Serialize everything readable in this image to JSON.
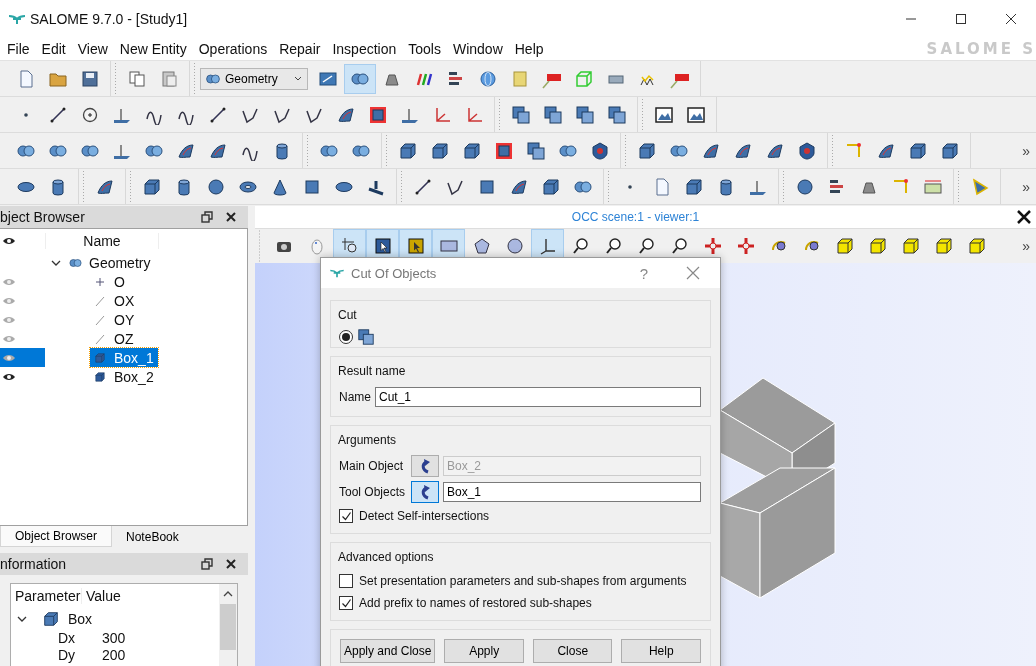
{
  "window": {
    "title": "SALOME  9.7.0 - [Study1]"
  },
  "menu": [
    "File",
    "Edit",
    "View",
    "New Entity",
    "Operations",
    "Repair",
    "Inspection",
    "Tools",
    "Window",
    "Help"
  ],
  "brand": "SALOME S",
  "toolbars": [
    {
      "groups": [
        {
          "buttons": [
            {
              "pressed": false
            },
            {
              "pressed": false
            },
            {
              "pressed": false
            }
          ]
        },
        {
          "buttons": [
            {
              "pressed": false
            },
            {
              "pressed": false
            }
          ]
        },
        {
          "combo": "Geometry",
          "buttons": [
            {
              "pressed": false
            },
            {
              "pressed": true
            },
            {
              "pressed": false
            },
            {
              "pressed": false
            },
            {
              "pressed": false
            },
            {
              "pressed": false
            },
            {
              "pressed": false
            },
            {
              "pressed": false
            },
            {
              "pressed": false
            },
            {
              "pressed": false
            },
            {
              "pressed": false
            },
            {
              "pressed": false
            }
          ]
        }
      ]
    },
    {
      "groups": [
        {
          "buttons": [
            {
              "pressed": false
            },
            {
              "pressed": false
            },
            {
              "pressed": false
            },
            {
              "pressed": false
            },
            {
              "pressed": false
            },
            {
              "pressed": false
            },
            {
              "pressed": false
            },
            {
              "pressed": false
            },
            {
              "pressed": false
            },
            {
              "pressed": false
            },
            {
              "pressed": false
            },
            {
              "pressed": false
            },
            {
              "pressed": false
            },
            {
              "pressed": false
            },
            {
              "pressed": false
            }
          ]
        },
        {
          "buttons": [
            {
              "pressed": false
            },
            {
              "pressed": false
            },
            {
              "pressed": false
            },
            {
              "pressed": false
            }
          ]
        },
        {
          "buttons": [
            {
              "pressed": false
            },
            {
              "pressed": false
            }
          ]
        }
      ]
    },
    {
      "overflow": "»",
      "groups": [
        {
          "buttons": [
            {
              "pressed": false
            },
            {
              "pressed": false
            },
            {
              "pressed": false
            },
            {
              "pressed": false
            },
            {
              "pressed": false
            },
            {
              "pressed": false
            },
            {
              "pressed": false
            },
            {
              "pressed": false
            },
            {
              "pressed": false
            }
          ]
        },
        {
          "buttons": [
            {
              "pressed": false
            },
            {
              "pressed": false
            }
          ]
        },
        {
          "buttons": [
            {
              "pressed": false
            },
            {
              "pressed": false
            },
            {
              "pressed": false
            },
            {
              "pressed": false
            },
            {
              "pressed": false
            },
            {
              "pressed": false
            },
            {
              "pressed": false
            }
          ]
        },
        {
          "buttons": [
            {
              "pressed": false
            },
            {
              "pressed": false
            },
            {
              "pressed": false
            },
            {
              "pressed": false
            },
            {
              "pressed": false
            },
            {
              "pressed": false
            }
          ]
        },
        {
          "buttons": [
            {
              "pressed": false
            },
            {
              "pressed": false
            },
            {
              "pressed": false
            },
            {
              "pressed": false
            }
          ]
        }
      ]
    },
    {
      "overflow": "»",
      "groups": [
        {
          "buttons": [
            {
              "pressed": false
            },
            {
              "pressed": false
            }
          ]
        },
        {
          "buttons": [
            {
              "pressed": false
            }
          ]
        },
        {
          "buttons": [
            {
              "pressed": false
            },
            {
              "pressed": false
            },
            {
              "pressed": false
            },
            {
              "pressed": false
            },
            {
              "pressed": false
            },
            {
              "pressed": false
            },
            {
              "pressed": false
            },
            {
              "pressed": false
            }
          ]
        },
        {
          "buttons": [
            {
              "pressed": false
            },
            {
              "pressed": false
            },
            {
              "pressed": false
            },
            {
              "pressed": false
            },
            {
              "pressed": false
            },
            {
              "pressed": false
            }
          ]
        },
        {
          "buttons": [
            {
              "pressed": false
            },
            {
              "pressed": false
            },
            {
              "pressed": false
            },
            {
              "pressed": false
            },
            {
              "pressed": false
            }
          ]
        },
        {
          "buttons": [
            {
              "pressed": false
            },
            {
              "pressed": false
            },
            {
              "pressed": false
            },
            {
              "pressed": false
            },
            {
              "pressed": false
            }
          ]
        },
        {
          "buttons": [
            {
              "pressed": false
            }
          ]
        }
      ]
    }
  ],
  "object_browser": {
    "title": "bject Browser",
    "header": "Name",
    "tree": [
      {
        "name": "Geometry",
        "expanded": true,
        "children": [
          {
            "name": "O",
            "kind": "point",
            "visible": false,
            "selected": false
          },
          {
            "name": "OX",
            "kind": "line",
            "visible": false,
            "selected": false
          },
          {
            "name": "OY",
            "kind": "line",
            "visible": false,
            "selected": false
          },
          {
            "name": "OZ",
            "kind": "line",
            "visible": false,
            "selected": false
          },
          {
            "name": "Box_1",
            "kind": "solid",
            "visible": false,
            "selected": true
          },
          {
            "name": "Box_2",
            "kind": "solid",
            "visible": true,
            "selected": false
          }
        ]
      }
    ]
  },
  "panel_tabs": [
    {
      "label": "Object Browser",
      "selected": true
    },
    {
      "label": "NoteBook",
      "selected": false
    }
  ],
  "information": {
    "title": "nformation",
    "columns": [
      "Parameter",
      "Value"
    ],
    "rows": [
      {
        "name": "Box",
        "expanded": true,
        "children": [
          {
            "name": "Dx",
            "value": "300"
          },
          {
            "name": "Dy",
            "value": "200"
          }
        ]
      }
    ]
  },
  "viewer": {
    "title": "OCC scene:1 - viewer:1",
    "overflow": "»",
    "buttons": [
      {
        "pressed": false
      },
      {
        "pressed": false
      },
      {
        "pressed": true
      },
      {
        "pressed": true
      },
      {
        "pressed": true
      },
      {
        "pressed": true
      },
      {
        "pressed": false
      },
      {
        "pressed": false
      },
      {
        "pressed": true
      },
      {
        "pressed": false
      },
      {
        "pressed": false
      },
      {
        "pressed": false
      },
      {
        "pressed": false
      },
      {
        "pressed": false
      },
      {
        "pressed": false
      },
      {
        "pressed": false
      },
      {
        "pressed": false
      },
      {
        "pressed": false
      },
      {
        "pressed": false
      },
      {
        "pressed": false
      },
      {
        "pressed": false
      },
      {
        "pressed": false
      }
    ]
  },
  "dialog": {
    "title": "Cut Of Objects",
    "help": "?",
    "operation": {
      "title": "Cut",
      "options": [
        {
          "selected": true
        }
      ]
    },
    "result": {
      "title": "Result name",
      "label": "Name",
      "value": "Cut_1"
    },
    "arguments": {
      "title": "Arguments",
      "fields": [
        {
          "label": "Main Object",
          "value": "Box_2",
          "disabled": true,
          "pressed": false
        },
        {
          "label": "Tool Objects",
          "value": "Box_1",
          "disabled": false,
          "pressed": true
        }
      ],
      "checks": [
        {
          "label": "Detect Self-intersections",
          "checked": true
        }
      ]
    },
    "advanced": {
      "title": "Advanced options",
      "checks": [
        {
          "label": "Set presentation parameters and sub-shapes from arguments",
          "checked": false
        },
        {
          "label": "Add prefix to names of restored sub-shapes",
          "checked": true
        }
      ]
    },
    "buttons": [
      "Apply and Close",
      "Apply",
      "Close",
      "Help"
    ]
  }
}
